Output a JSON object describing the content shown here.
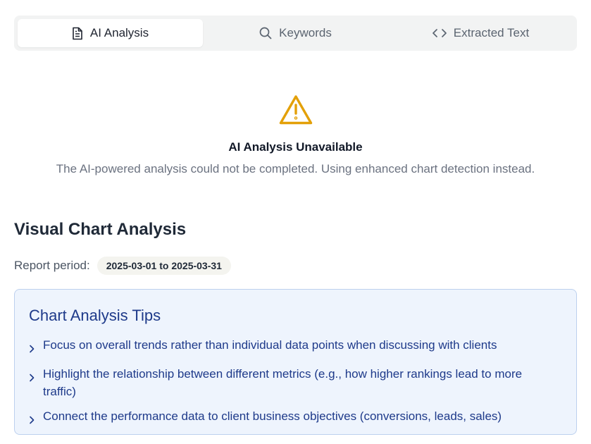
{
  "tabs": [
    {
      "label": "AI Analysis",
      "icon": "document-icon",
      "active": true
    },
    {
      "label": "Keywords",
      "icon": "search-icon",
      "active": false
    },
    {
      "label": "Extracted Text",
      "icon": "code-icon",
      "active": false
    }
  ],
  "warning": {
    "icon": "warning-triangle-icon",
    "color": "#e3a008",
    "title": "AI Analysis Unavailable",
    "message": "The AI-powered analysis could not be completed. Using enhanced chart detection instead."
  },
  "section": {
    "title": "Visual Chart Analysis",
    "report_period_label": "Report period:",
    "report_period_value": "2025-03-01 to 2025-03-31"
  },
  "tips": {
    "title": "Chart Analysis Tips",
    "items": [
      "Focus on overall trends rather than individual data points when discussing with clients",
      "Highlight the relationship between different metrics (e.g., how higher rankings lead to more traffic)",
      "Connect the performance data to client business objectives (conversions, leads, sales)"
    ]
  }
}
